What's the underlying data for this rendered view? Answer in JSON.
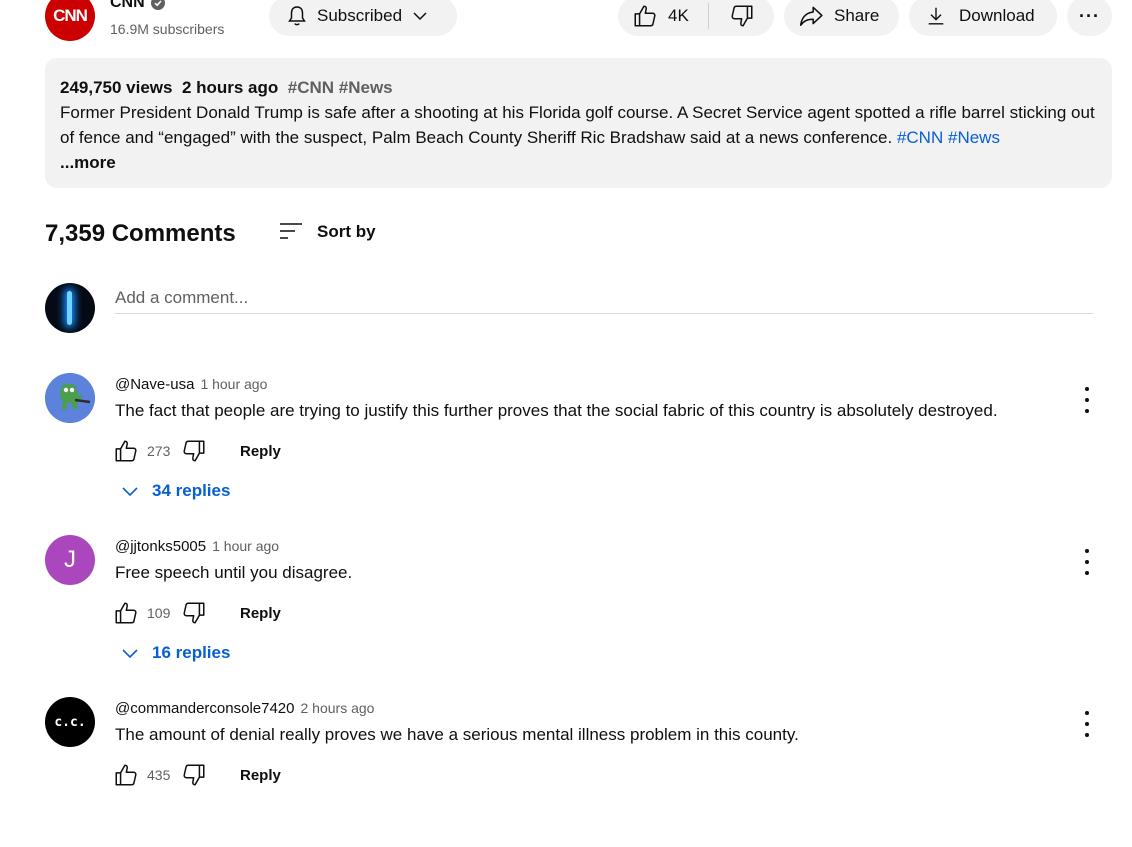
{
  "channel": {
    "logo_text": "CNN",
    "name": "CNN",
    "subscribers": "16.9M subscribers"
  },
  "actions": {
    "subscribe_label": "Subscribed",
    "like_count": "4K",
    "share_label": "Share",
    "download_label": "Download",
    "more_label": "···"
  },
  "description": {
    "views": "249,750 views",
    "time": "2 hours ago",
    "tags": "#CNN #News",
    "text": "Former President Donald Trump is safe after a shooting at his Florida golf course. A Secret Service agent spotted a rifle barrel sticking out of fence and “engaged” with the suspect, Palm Beach County Sheriff Ric Bradshaw said at a news conference.",
    "hashtag_1": "#CNN",
    "hashtag_2": "#News",
    "more_label": "...more"
  },
  "comments_header": {
    "count": "7,359 Comments",
    "sort_label": "Sort by"
  },
  "add_comment": {
    "placeholder": "Add a comment..."
  },
  "comments": [
    {
      "author": "@Nave-usa",
      "time": "1 hour ago",
      "text": "The fact that people are trying to justify this further proves that the social fabric of this country is absolutely destroyed.",
      "likes": "273",
      "reply_label": "Reply",
      "replies": "34 replies"
    },
    {
      "author": "@jjtonks5005",
      "time": "1 hour ago",
      "text": "Free speech until you disagree.",
      "likes": "109",
      "reply_label": "Reply",
      "replies": "16 replies",
      "avatar_letter": "J"
    },
    {
      "author": "@commanderconsole7420",
      "time": "2 hours ago",
      "text": "The amount of denial really proves we have a serious mental illness problem in this county.",
      "likes": "435",
      "reply_label": "Reply",
      "avatar_text": "c.c."
    }
  ],
  "colors": {
    "brand_red": "#cc0000",
    "link_blue": "#065fd4",
    "pill_bg": "#f2f2f2",
    "avatar_purple": "#ab47bc"
  }
}
